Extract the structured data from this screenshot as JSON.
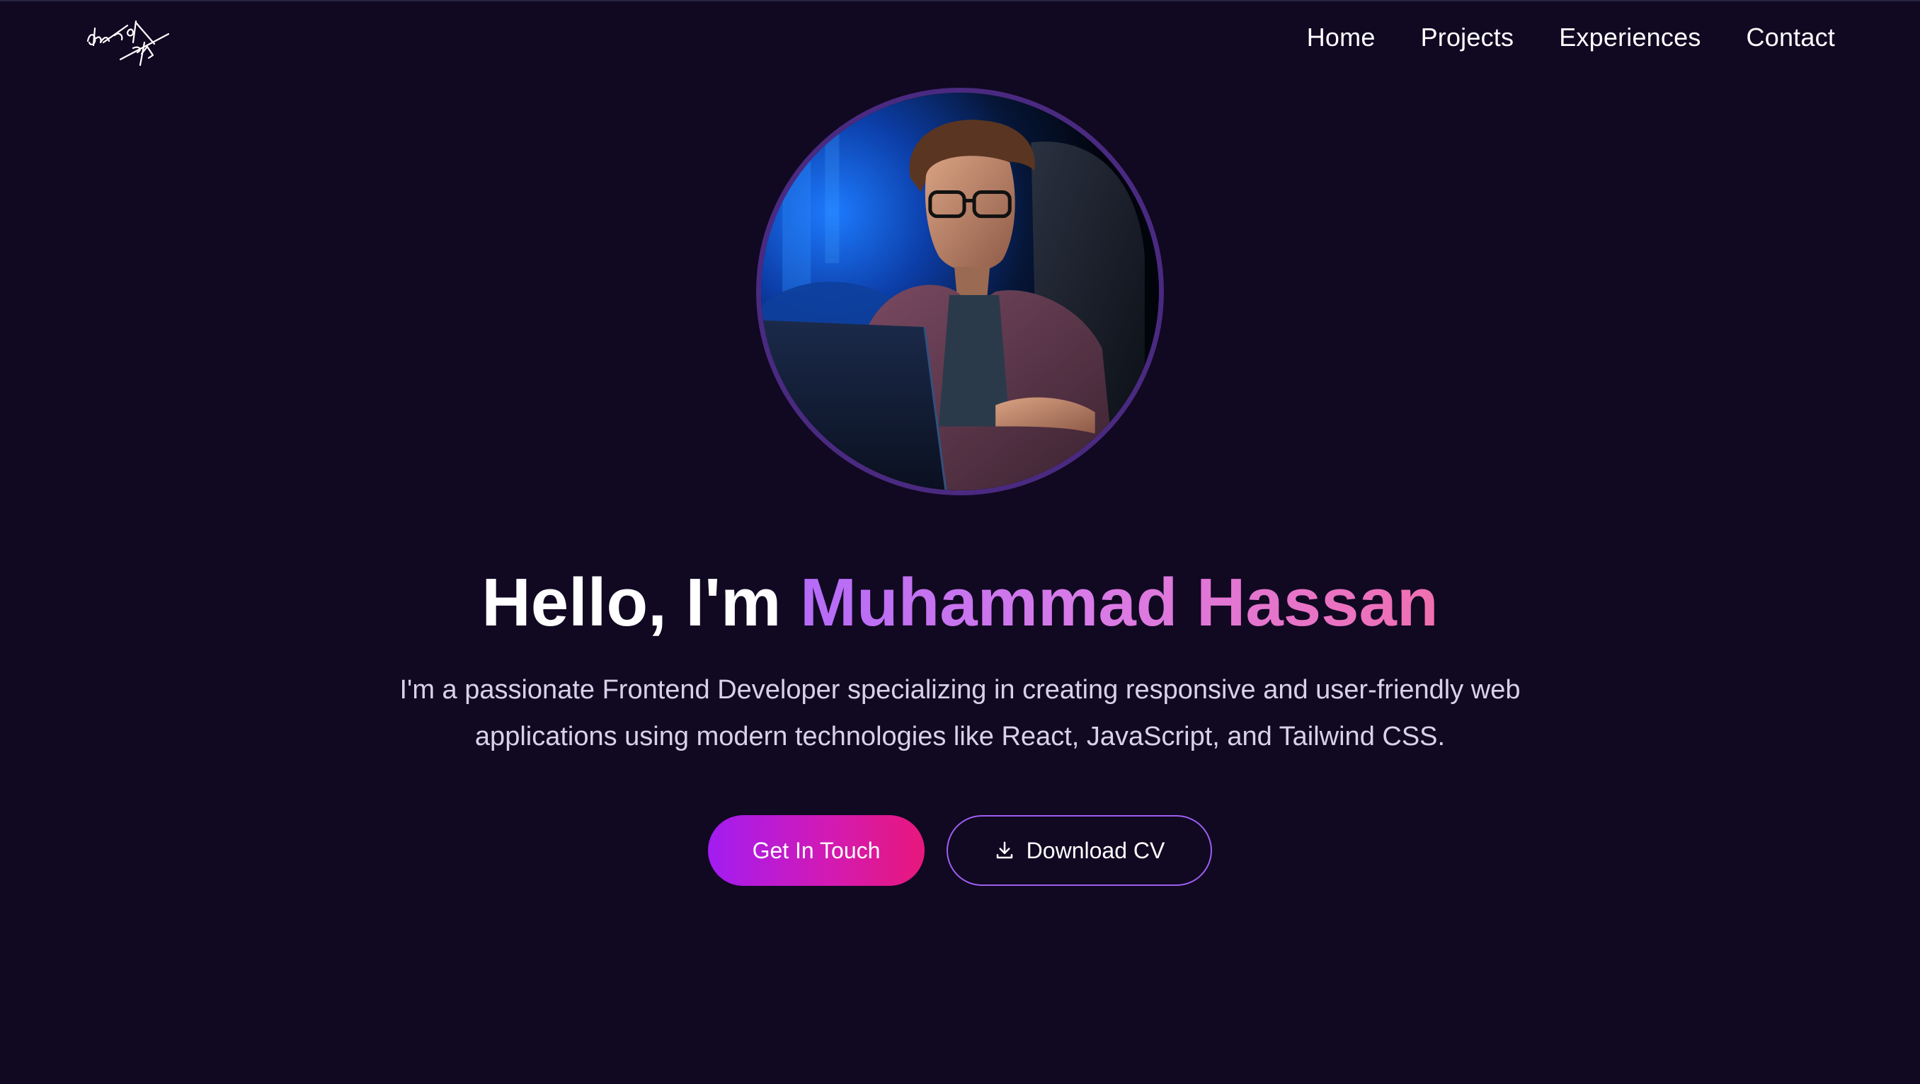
{
  "header": {
    "logo_alt": "signature logo",
    "nav": [
      {
        "label": "Home"
      },
      {
        "label": "Projects"
      },
      {
        "label": "Experiences"
      },
      {
        "label": "Contact"
      }
    ]
  },
  "hero": {
    "avatar": "portrait-photo",
    "greeting": "Hello, I'm ",
    "name": "Muhammad Hassan",
    "description": "I'm a passionate Frontend Developer specializing in creating responsive and user-friendly web applications using modern technologies like React, JavaScript, and Tailwind CSS.",
    "buttons": {
      "primary_label": "Get In Touch",
      "secondary_label": "Download CV",
      "secondary_icon": "download-icon"
    }
  },
  "colors": {
    "background": "#110822",
    "accent_purple": "#a21cf2",
    "accent_pink": "#e8187c",
    "name_gradient_start": "#b46bf7",
    "name_gradient_end": "#f06fb1",
    "avatar_ring": "#4a2a80",
    "outline_button_border": "#9d5ff0",
    "body_text": "#d9d2e6"
  }
}
